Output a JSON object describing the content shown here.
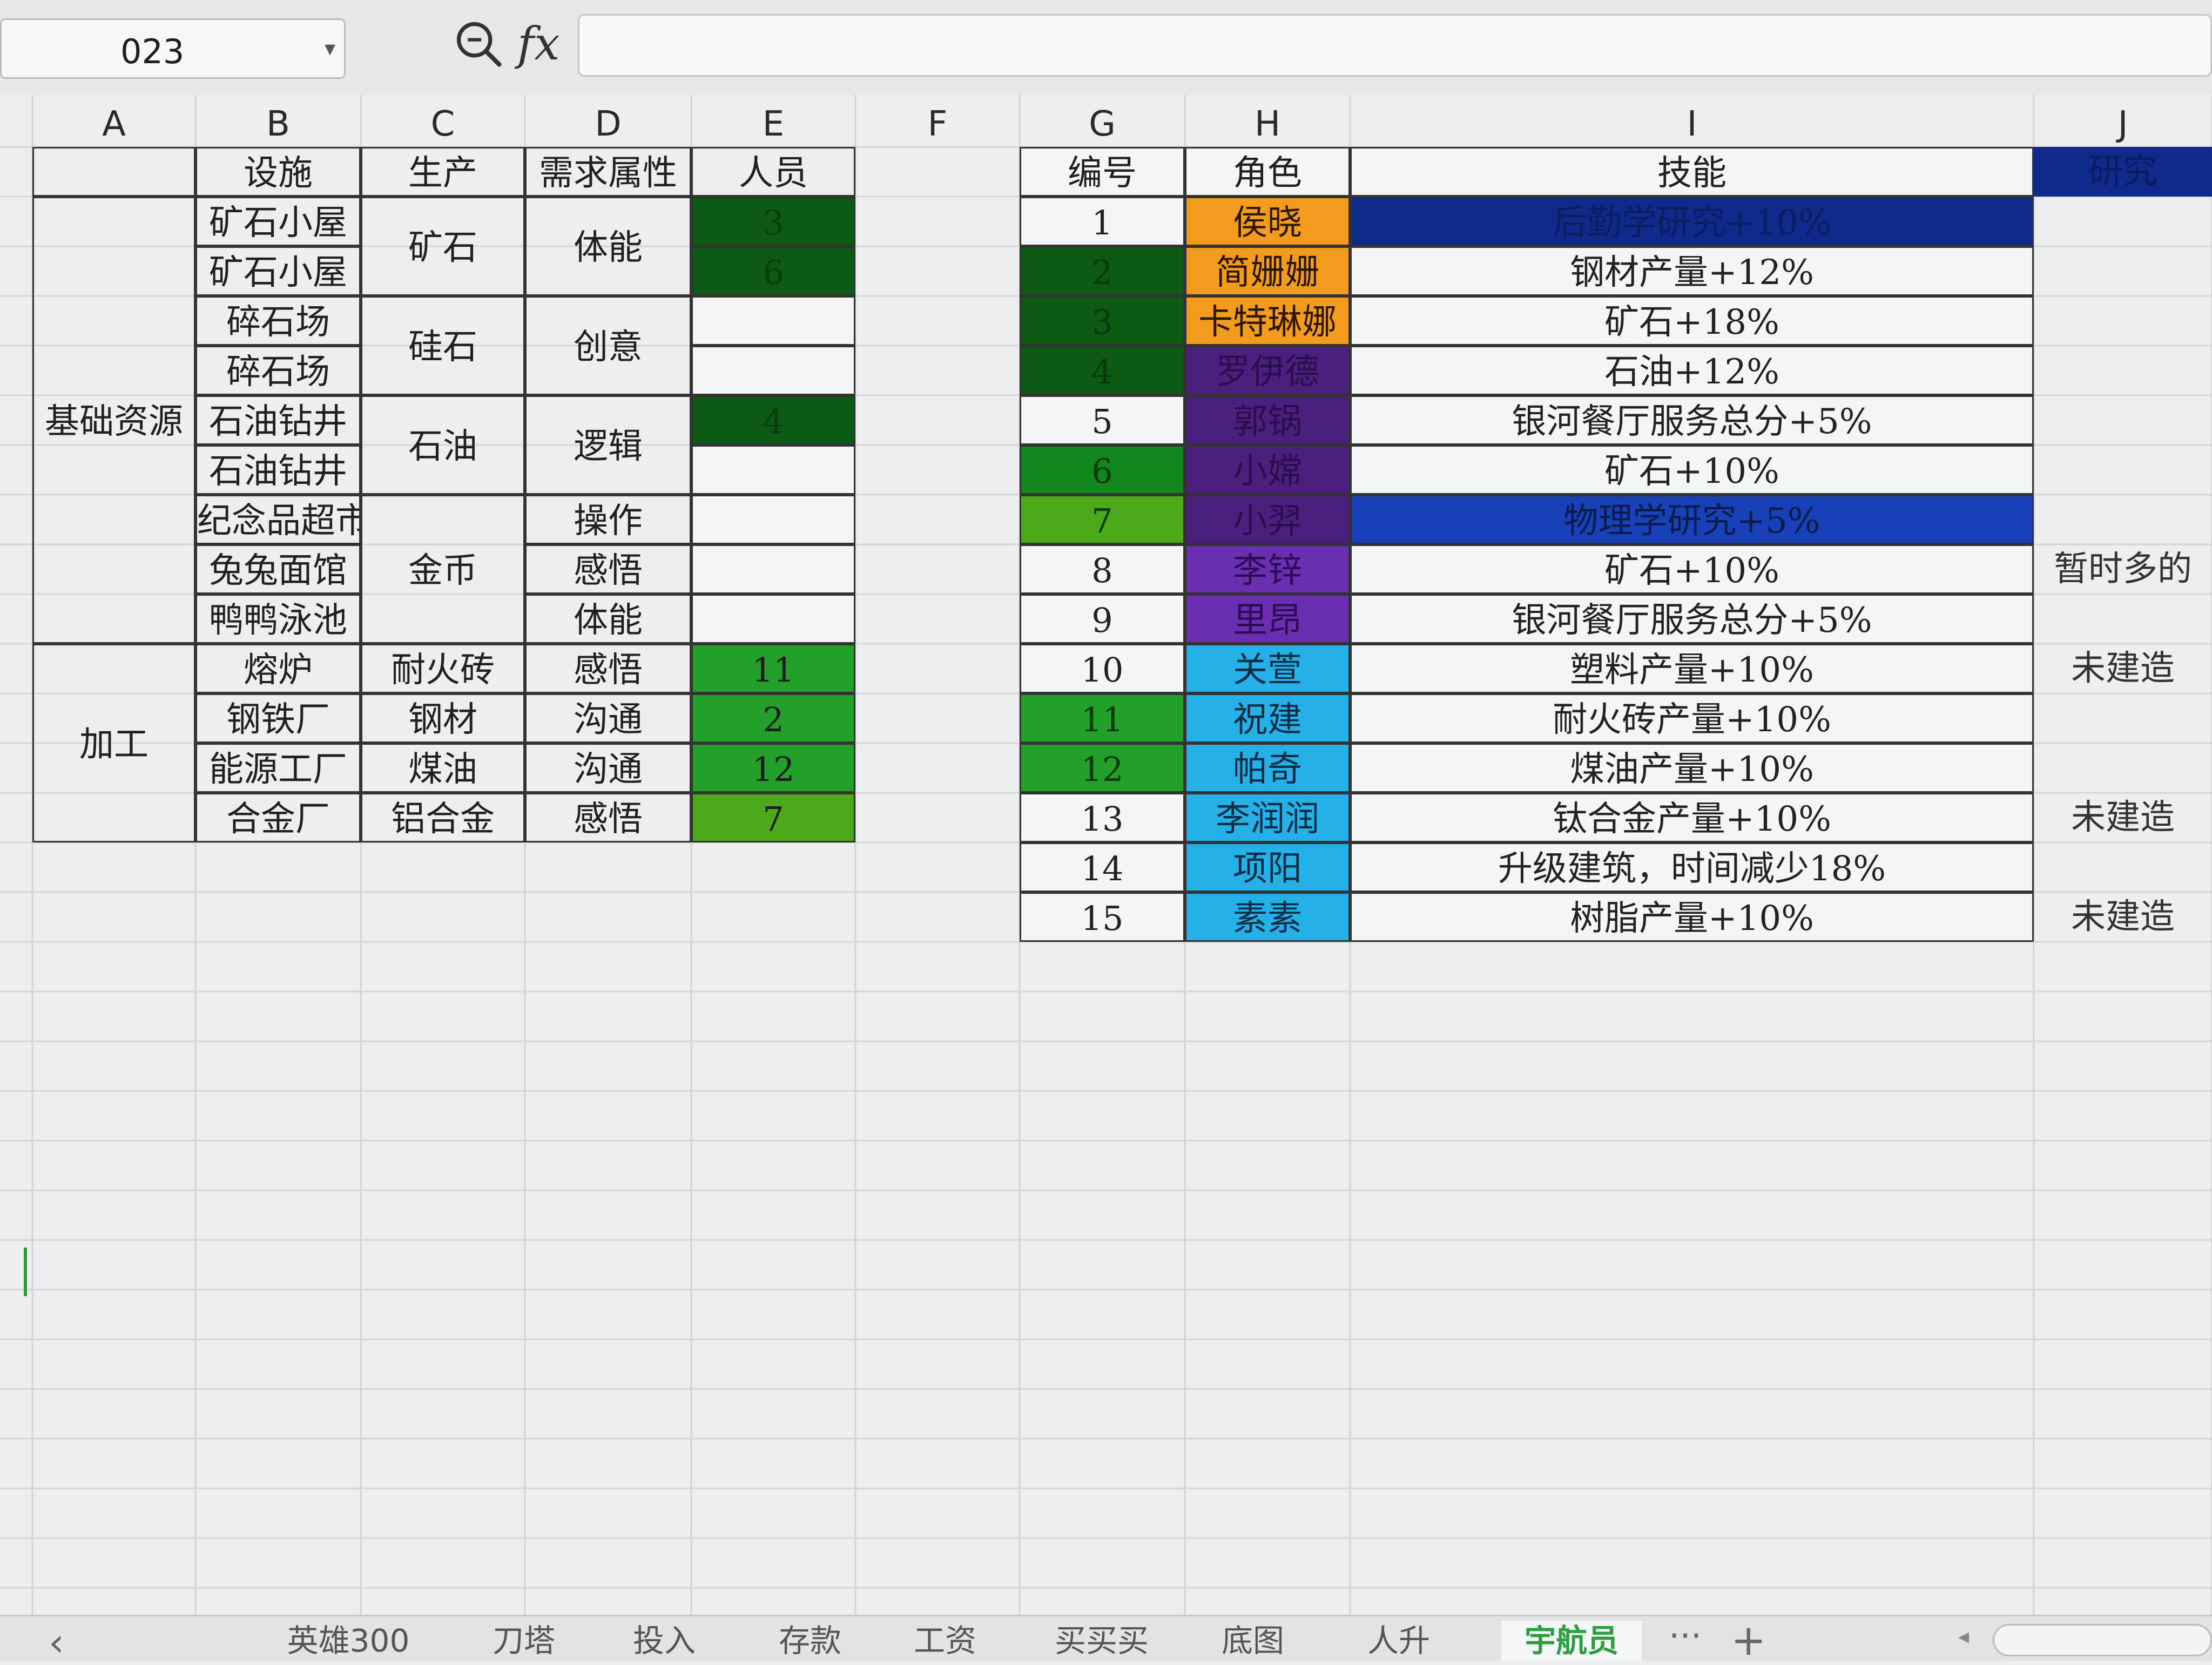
{
  "formula_bar": {
    "cell_ref": "023",
    "fx_label": "fx"
  },
  "columns": [
    "A",
    "B",
    "C",
    "D",
    "E",
    "F",
    "G",
    "H",
    "I",
    "J"
  ],
  "left_table": {
    "headers": {
      "facility": "设施",
      "production": "生产",
      "attribute": "需求属性",
      "staff": "人员"
    },
    "groups": [
      {
        "name": "基础资源",
        "rows": [
          {
            "facility": "矿石小屋",
            "staff": "3"
          },
          {
            "facility": "矿石小屋",
            "staff": "6"
          },
          {
            "facility": "碎石场",
            "staff": ""
          },
          {
            "facility": "碎石场",
            "staff": ""
          },
          {
            "facility": "石油钻井",
            "staff": "4"
          },
          {
            "facility": "石油钻井",
            "staff": ""
          },
          {
            "facility": "纪念品超市",
            "staff": ""
          },
          {
            "facility": "兔兔面馆",
            "staff": ""
          },
          {
            "facility": "鸭鸭泳池",
            "staff": ""
          }
        ]
      },
      {
        "name": "加工",
        "rows": [
          {
            "facility": "熔炉",
            "staff": "11"
          },
          {
            "facility": "钢铁厂",
            "staff": "2"
          },
          {
            "facility": "能源工厂",
            "staff": "12"
          },
          {
            "facility": "合金厂",
            "staff": "7"
          }
        ]
      }
    ],
    "production_merged": [
      "矿石",
      "硅石",
      "石油",
      "金币",
      "耐火砖",
      "钢材",
      "煤油",
      "铝合金"
    ],
    "attribute_values": [
      "体能",
      "创意",
      "逻辑",
      "操作",
      "感悟",
      "体能",
      "感悟",
      "沟通",
      "沟通",
      "感悟"
    ]
  },
  "right_table": {
    "headers": {
      "id": "编号",
      "role": "角色",
      "skill": "技能",
      "research": "研究"
    },
    "rows": [
      {
        "id": "1",
        "role": "侯晓",
        "skill": "后勤学研究+10%",
        "note": ""
      },
      {
        "id": "2",
        "role": "简姗姗",
        "skill": "钢材产量+12%",
        "note": ""
      },
      {
        "id": "3",
        "role": "卡特琳娜",
        "skill": "矿石+18%",
        "note": ""
      },
      {
        "id": "4",
        "role": "罗伊德",
        "skill": "石油+12%",
        "note": ""
      },
      {
        "id": "5",
        "role": "郭锅",
        "skill": "银河餐厅服务总分+5%",
        "note": ""
      },
      {
        "id": "6",
        "role": "小嫦",
        "skill": "矿石+10%",
        "note": ""
      },
      {
        "id": "7",
        "role": "小羿",
        "skill": "物理学研究+5%",
        "note": ""
      },
      {
        "id": "8",
        "role": "李锌",
        "skill": "矿石+10%",
        "note": "暂时多的"
      },
      {
        "id": "9",
        "role": "里昂",
        "skill": "银河餐厅服务总分+5%",
        "note": ""
      },
      {
        "id": "10",
        "role": "关萱",
        "skill": "塑料产量+10%",
        "note": "未建造"
      },
      {
        "id": "11",
        "role": "祝建",
        "skill": "耐火砖产量+10%",
        "note": ""
      },
      {
        "id": "12",
        "role": "帕奇",
        "skill": "煤油产量+10%",
        "note": ""
      },
      {
        "id": "13",
        "role": "李润润",
        "skill": "钛合金产量+10%",
        "note": "未建造"
      },
      {
        "id": "14",
        "role": "项阳",
        "skill": "升级建筑，时间减少18%",
        "note": ""
      },
      {
        "id": "15",
        "role": "素素",
        "skill": "树脂产量+10%",
        "note": "未建造"
      }
    ]
  },
  "colors": {
    "dark_green": "#0c5a14",
    "mid_green": "#14861e",
    "green": "#22a02a",
    "light_green": "#4caa1a",
    "orange": "#f29b1e",
    "purple_dark": "#4a1f7e",
    "purple": "#6a2fb0",
    "cyan": "#25b0e8",
    "navy": "#0f2a8a",
    "blue": "#1840b8"
  },
  "sheet_tabs": [
    "英雄300",
    "刀塔",
    "投入",
    "存款",
    "工资",
    "买买买",
    "底图",
    "人升",
    "宇航员"
  ],
  "active_tab": "宇航员",
  "tab_more": "···",
  "tab_add": "+"
}
